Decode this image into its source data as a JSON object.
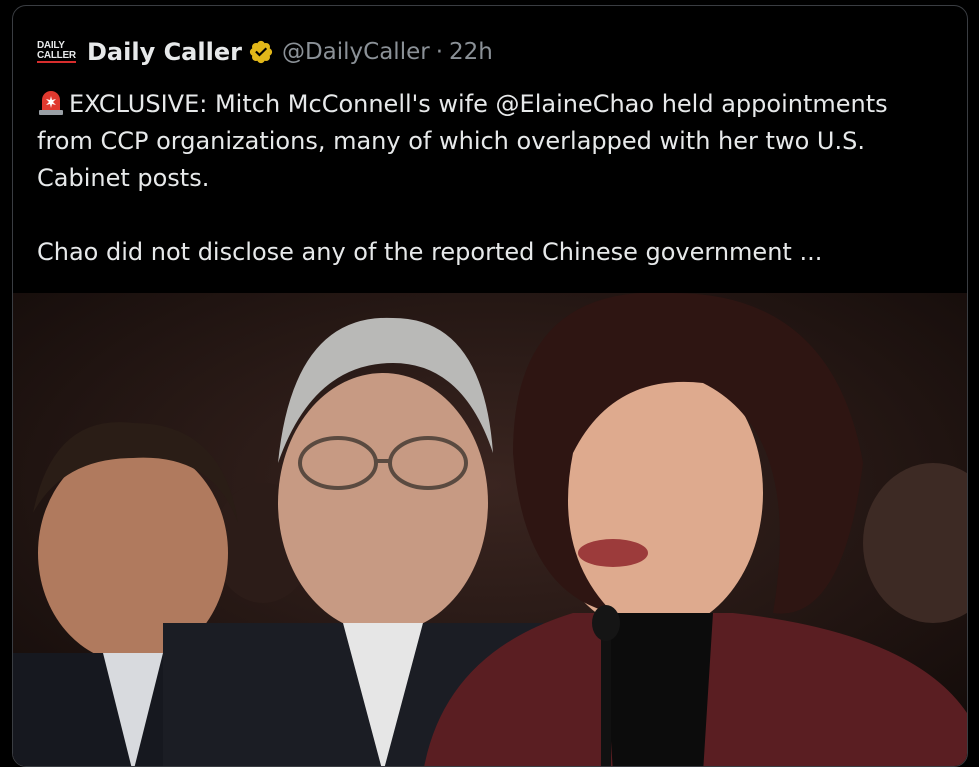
{
  "tweet": {
    "account_name": "Daily Caller",
    "handle": "@DailyCaller",
    "separator": "·",
    "time": "22h",
    "logo_line1": "DAILY",
    "logo_line2": "CALLER",
    "verified_icon": "verified-badge-gold",
    "text_line1": "EXCLUSIVE: Mitch McConnell's wife @ElaineChao held appointments from CCP organizations, many of which overlapped with her two U.S. Cabinet posts.",
    "text_line2": "Chao did not disclose any of the reported Chinese government ...",
    "siren_icon": "rotating-light-emoji"
  },
  "colors": {
    "background": "#000000",
    "text": "#e7e9ea",
    "muted": "#8b9197",
    "verified_gold": "#e2b719",
    "border": "#3a3d42"
  }
}
